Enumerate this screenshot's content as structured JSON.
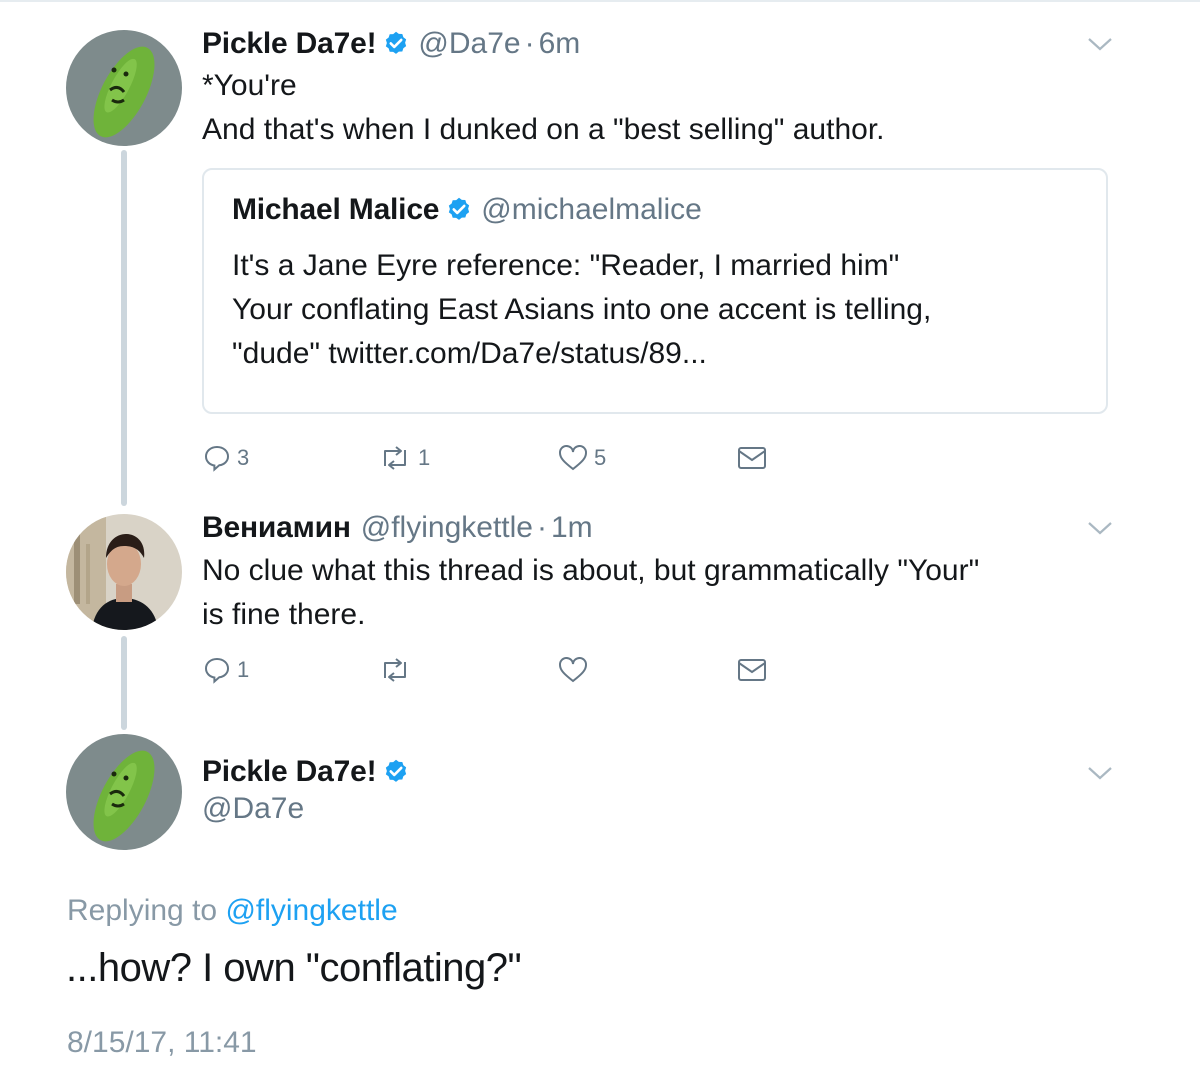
{
  "colors": {
    "verified": "#1da1f2",
    "link": "#1da1f2",
    "secondary_text": "#657786",
    "thread_line": "#ccd6dd",
    "card_border": "#e1e8ed"
  },
  "tweets": [
    {
      "display_name": "Pickle Da7e!",
      "verified": true,
      "handle": "@Da7e",
      "separator": "·",
      "time": "6m",
      "lines": [
        "*You're",
        "And that's when I dunked on a \"best selling\" author."
      ],
      "quote": {
        "display_name": "Michael Malice",
        "verified": true,
        "handle": "@michaelmalice",
        "lines": [
          "It's a Jane Eyre reference: \"Reader, I married him\"",
          "Your conflating East Asians into one accent is telling,",
          "\"dude\" twitter.com/Da7e/status/89..."
        ]
      },
      "actions": {
        "replies": "3",
        "retweets": "1",
        "likes": "5"
      },
      "avatar_icon": "pickle-avatar"
    },
    {
      "display_name": "Вениамин",
      "verified": false,
      "handle": "@flyingkettle",
      "separator": "·",
      "time": "1m",
      "lines": [
        "No clue what this thread is about, but grammatically \"Your\"",
        "is fine there."
      ],
      "actions": {
        "replies": "1",
        "retweets": "",
        "likes": ""
      },
      "avatar_icon": "person-avatar"
    }
  ],
  "focused_tweet": {
    "display_name": "Pickle Da7e!",
    "verified": true,
    "handle": "@Da7e",
    "replying_prefix": "Replying to",
    "replying_to": "@flyingkettle",
    "text": "...how? I own \"conflating?\"",
    "timestamp": "8/15/17, 11:41"
  }
}
